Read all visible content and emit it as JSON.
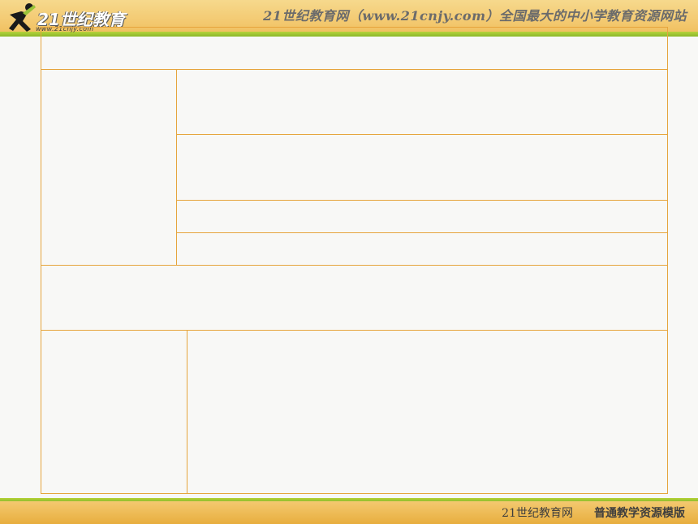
{
  "header": {
    "banner": "21世纪教育网（www.21cnjy.com）全国最大的中小学教育资源网站",
    "logo_text": "21世纪教育",
    "logo_url": "www.21cnjy.com"
  },
  "footer": {
    "brand": "21世纪教育网",
    "tagline": "普通教学资源模版"
  },
  "colors": {
    "border": "#e6a53d",
    "header": "#f3c970",
    "green_strip": "#8ab82a",
    "background": "#f8f8f6"
  },
  "table": {
    "cells": [
      "",
      "",
      "",
      "",
      "",
      "",
      "",
      "",
      "",
      ""
    ]
  }
}
